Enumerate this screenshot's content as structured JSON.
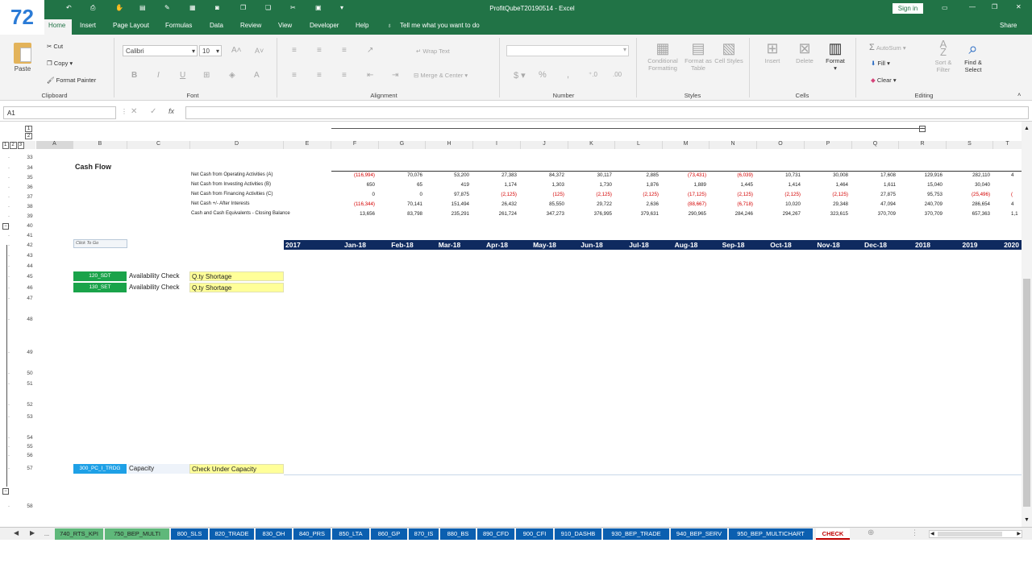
{
  "badge": {
    "number": "72"
  },
  "titlebar": {
    "title": "ProfitQubeT20190514  -  Excel",
    "signin": "Sign in"
  },
  "ribbon_tabs": [
    "Home",
    "Insert",
    "Page Layout",
    "Formulas",
    "Data",
    "Review",
    "View",
    "Developer",
    "Help"
  ],
  "tell_me": "Tell me what you want to do",
  "share": "Share",
  "clipboard": {
    "paste": "Paste",
    "cut": "Cut",
    "copy": "Copy",
    "format_painter": "Format Painter",
    "label": "Clipboard"
  },
  "font": {
    "name": "Calibri",
    "size": "10",
    "label": "Font"
  },
  "alignment": {
    "wrap": "Wrap Text",
    "merge": "Merge & Center",
    "label": "Alignment"
  },
  "number": {
    "label": "Number"
  },
  "styles": {
    "conditional": "Conditional Formatting",
    "format_as": "Format as Table",
    "cell_styles": "Cell Styles",
    "label": "Styles"
  },
  "cells": {
    "insert": "Insert",
    "delete": "Delete",
    "format": "Format",
    "label": "Cells"
  },
  "editing": {
    "autosum": "AutoSum",
    "fill": "Fill",
    "clear": "Clear",
    "sort": "Sort & Filter",
    "find": "Find & Select",
    "label": "Editing"
  },
  "formula_bar": {
    "namebox": "A1",
    "fx": "fx",
    "value": ""
  },
  "columns": [
    "A",
    "B",
    "C",
    "D",
    "E",
    "F",
    "G",
    "H",
    "I",
    "J",
    "K",
    "L",
    "M",
    "N",
    "O",
    "P",
    "Q",
    "R",
    "S",
    "T"
  ],
  "rows": [
    "33",
    "34",
    "35",
    "36",
    "37",
    "38",
    "39",
    "40",
    "41",
    "42",
    "43",
    "44",
    "45",
    "46",
    "47",
    "48",
    "49",
    "50",
    "51",
    "52",
    "53",
    "54",
    "55",
    "56",
    "57",
    "58"
  ],
  "outline_levels": [
    "1",
    "2",
    "3"
  ],
  "cashflow": {
    "title": "Cash Flow",
    "lines": [
      {
        "label": "Net Cash from Operating Activities (A)",
        "values": [
          "(116,994)",
          "70,076",
          "53,200",
          "27,383",
          "84,372",
          "30,117",
          "2,885",
          "(73,431)",
          "(6,039)",
          "10,731",
          "30,008",
          "17,608",
          "129,916",
          "282,110",
          "4"
        ]
      },
      {
        "label": "Net Cash from Investing Activities (B)",
        "values": [
          "650",
          "65",
          "419",
          "1,174",
          "1,303",
          "1,730",
          "1,876",
          "1,889",
          "1,445",
          "1,414",
          "1,464",
          "1,611",
          "15,040",
          "30,040",
          ""
        ]
      },
      {
        "label": "Net Cash from Financing Activities (C)",
        "values": [
          "0",
          "0",
          "97,875",
          "(2,125)",
          "(125)",
          "(2,125)",
          "(2,125)",
          "(17,125)",
          "(2,125)",
          "(2,125)",
          "(2,125)",
          "27,875",
          "95,753",
          "(25,496)",
          "("
        ]
      },
      {
        "label": "Net Cash +/- After Interests",
        "values": [
          "(116,344)",
          "70,141",
          "151,494",
          "26,432",
          "85,550",
          "29,722",
          "2,636",
          "(88,667)",
          "(6,718)",
          "10,020",
          "29,348",
          "47,094",
          "240,709",
          "286,654",
          "4"
        ]
      },
      {
        "label": "Cash and Cash Equivalents - Closing Balance",
        "values": [
          "13,656",
          "83,798",
          "235,291",
          "261,724",
          "347,273",
          "376,995",
          "379,631",
          "290,965",
          "284,246",
          "294,267",
          "323,615",
          "370,709",
          "370,709",
          "657,363",
          "1,1"
        ]
      }
    ]
  },
  "click_to_go": "Click To Go",
  "month_headers": [
    "2017",
    "Jan-18",
    "Feb-18",
    "Mar-18",
    "Apr-18",
    "May-18",
    "Jun-18",
    "Jul-18",
    "Aug-18",
    "Sep-18",
    "Oct-18",
    "Nov-18",
    "Dec-18",
    "2018",
    "2019",
    "2020"
  ],
  "checks": [
    {
      "code": "120_SDT",
      "name": "Availability Check",
      "result": "Q.ty Shortage",
      "color": "#1aa34a"
    },
    {
      "code": "130_SET",
      "name": "Availability Check",
      "result": "Q.ty Shortage",
      "color": "#1aa34a"
    },
    {
      "code": "300_PC_I_TRDG",
      "name": "Capacity",
      "result": "Check Under Capacity",
      "color": "#1ea0e6"
    }
  ],
  "sheet_tabs": [
    "...",
    "740_RTS_KPI",
    "750_BEP_MULTI",
    "800_SLS",
    "820_TRADE",
    "830_OH",
    "840_PRS",
    "850_LTA",
    "860_GP",
    "870_IS",
    "880_BS",
    "890_CFD",
    "900_CFI",
    "910_DASHB",
    "930_BEP_TRADE",
    "940_BEP_SERV",
    "950_BEP_MULTICHART",
    "CHECK"
  ],
  "colors": {
    "excel_green": "#217346",
    "navy": "#0f2a5f",
    "tab_blue": "#0b5fb0",
    "tab_green": "#5fb87a",
    "yellow": "#ffff99"
  }
}
